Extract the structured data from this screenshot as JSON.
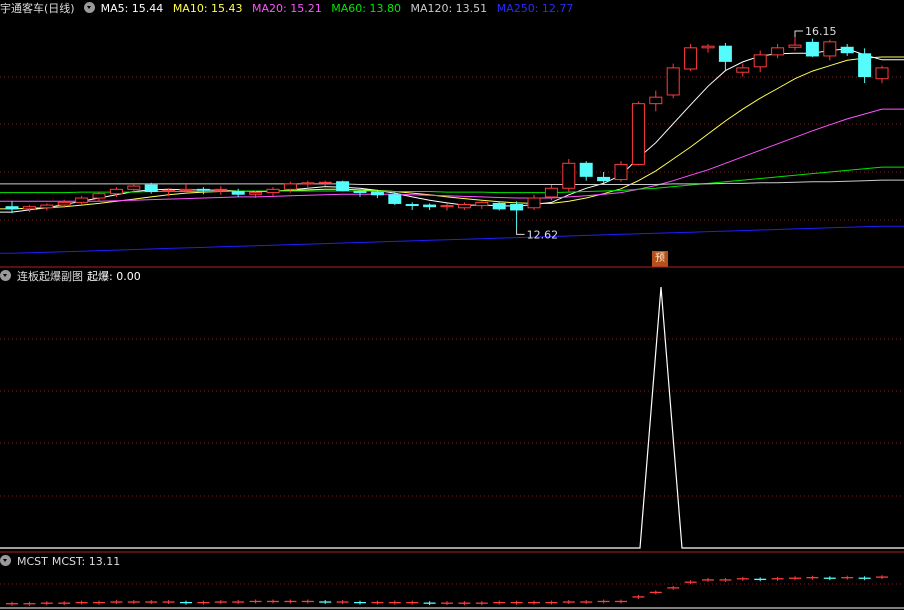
{
  "header": {
    "title": "宇通客车(日线)",
    "ma5": "MA5: 15.44",
    "ma10": "MA10: 15.43",
    "ma20": "MA20: 15.21",
    "ma60": "MA60: 13.80",
    "ma120": "MA120: 13.51",
    "ma250": "MA250: 12.77"
  },
  "price_panel": {
    "high_label": "16.15",
    "low_label": "12.62",
    "predict_badge": "预"
  },
  "panel2": {
    "title": "连板起爆副图",
    "value": "起爆: 0.00"
  },
  "panel3": {
    "title": "MCST",
    "value": "MCST: 13.11"
  },
  "colors": {
    "bg": "#000000",
    "up": "#ff3c3c",
    "down": "#54fcfc",
    "ma5": "#ffffff",
    "ma10": "#ffff54",
    "ma20": "#ff54ff",
    "ma60": "#00e600",
    "ma120": "#cccccc",
    "ma250": "#1e1eff",
    "grid": "#8a1a1a"
  },
  "chart_data": [
    {
      "type": "candlestick",
      "ohlc": [
        [
          13.02,
          13.12,
          12.9,
          12.98
        ],
        [
          12.98,
          13.05,
          12.92,
          13.02
        ],
        [
          13.0,
          13.08,
          12.95,
          13.05
        ],
        [
          13.05,
          13.15,
          13.0,
          13.1
        ],
        [
          13.1,
          13.22,
          13.05,
          13.18
        ],
        [
          13.18,
          13.3,
          13.12,
          13.26
        ],
        [
          13.26,
          13.38,
          13.2,
          13.34
        ],
        [
          13.34,
          13.44,
          13.28,
          13.4
        ],
        [
          13.42,
          13.46,
          13.26,
          13.3
        ],
        [
          13.3,
          13.36,
          13.22,
          13.32
        ],
        [
          13.32,
          13.46,
          13.27,
          13.34
        ],
        [
          13.34,
          13.38,
          13.25,
          13.33
        ],
        [
          13.33,
          13.4,
          13.24,
          13.34
        ],
        [
          13.3,
          13.35,
          13.2,
          13.25
        ],
        [
          13.25,
          13.32,
          13.18,
          13.28
        ],
        [
          13.28,
          13.38,
          13.22,
          13.34
        ],
        [
          13.34,
          13.48,
          13.28,
          13.44
        ],
        [
          13.44,
          13.5,
          13.36,
          13.46
        ],
        [
          13.46,
          13.5,
          13.4,
          13.47
        ],
        [
          13.48,
          13.5,
          13.3,
          13.32
        ],
        [
          13.3,
          13.34,
          13.2,
          13.29
        ],
        [
          13.29,
          13.32,
          13.18,
          13.24
        ],
        [
          13.24,
          13.3,
          13.05,
          13.08
        ],
        [
          13.06,
          13.1,
          12.96,
          13.05
        ],
        [
          13.05,
          13.08,
          12.96,
          13.02
        ],
        [
          13.02,
          13.08,
          12.95,
          13.04
        ],
        [
          13.0,
          13.1,
          12.96,
          13.06
        ],
        [
          13.04,
          13.12,
          12.98,
          13.1
        ],
        [
          13.08,
          13.12,
          12.95,
          12.98
        ],
        [
          13.06,
          13.12,
          12.62,
          12.96
        ],
        [
          13.0,
          13.24,
          12.96,
          13.18
        ],
        [
          13.2,
          13.42,
          13.14,
          13.36
        ],
        [
          13.36,
          13.9,
          13.3,
          13.82
        ],
        [
          13.82,
          13.86,
          13.5,
          13.58
        ],
        [
          13.56,
          13.66,
          13.46,
          13.5
        ],
        [
          13.52,
          13.86,
          13.48,
          13.8
        ],
        [
          13.8,
          14.96,
          13.78,
          14.92
        ],
        [
          14.92,
          15.16,
          14.78,
          15.04
        ],
        [
          15.08,
          15.66,
          15.02,
          15.58
        ],
        [
          15.56,
          16.02,
          15.52,
          15.95
        ],
        [
          15.95,
          16.02,
          15.86,
          15.98
        ],
        [
          15.98,
          16.04,
          15.54,
          15.7
        ],
        [
          15.5,
          15.66,
          15.42,
          15.58
        ],
        [
          15.6,
          15.9,
          15.5,
          15.82
        ],
        [
          15.82,
          16.02,
          15.76,
          15.95
        ],
        [
          15.96,
          16.15,
          15.9,
          16.0
        ],
        [
          16.05,
          16.12,
          15.78,
          15.8
        ],
        [
          15.8,
          16.1,
          15.72,
          16.06
        ],
        [
          15.96,
          16.02,
          15.8,
          15.86
        ],
        [
          15.84,
          15.94,
          15.3,
          15.42
        ],
        [
          15.38,
          15.62,
          15.3,
          15.58
        ]
      ],
      "ma_lines": {
        "MA5": [
          12.92,
          12.96,
          13.0,
          13.06,
          13.12,
          13.18,
          13.24,
          13.3,
          13.33,
          13.34,
          13.33,
          13.33,
          13.32,
          13.31,
          13.3,
          13.3,
          13.33,
          13.36,
          13.39,
          13.38,
          13.36,
          13.32,
          13.27,
          13.2,
          13.14,
          13.09,
          13.05,
          13.05,
          13.04,
          13.03,
          13.06,
          13.1,
          13.24,
          13.36,
          13.45,
          13.6,
          13.92,
          14.2,
          14.55,
          14.9,
          15.24,
          15.53,
          15.69,
          15.8,
          15.84,
          15.85,
          15.85,
          15.9,
          15.93,
          15.82,
          15.73
        ],
        "MA10": [
          12.98,
          12.99,
          13.0,
          13.02,
          13.05,
          13.08,
          13.12,
          13.16,
          13.2,
          13.24,
          13.27,
          13.29,
          13.3,
          13.31,
          13.31,
          13.31,
          13.32,
          13.33,
          13.34,
          13.34,
          13.33,
          13.32,
          13.3,
          13.27,
          13.24,
          13.2,
          13.17,
          13.14,
          13.11,
          13.09,
          13.08,
          13.08,
          13.12,
          13.18,
          13.26,
          13.35,
          13.5,
          13.68,
          13.9,
          14.12,
          14.36,
          14.6,
          14.82,
          15.02,
          15.2,
          15.38,
          15.52,
          15.62,
          15.72,
          15.76,
          15.78
        ],
        "MA20": [
          13.12,
          13.12,
          13.12,
          13.12,
          13.12,
          13.12,
          13.13,
          13.14,
          13.15,
          13.16,
          13.17,
          13.18,
          13.19,
          13.2,
          13.2,
          13.21,
          13.22,
          13.23,
          13.24,
          13.25,
          13.25,
          13.25,
          13.25,
          13.24,
          13.23,
          13.22,
          13.21,
          13.2,
          13.19,
          13.18,
          13.18,
          13.18,
          13.2,
          13.22,
          13.25,
          13.28,
          13.34,
          13.41,
          13.5,
          13.6,
          13.7,
          13.82,
          13.94,
          14.06,
          14.18,
          14.3,
          14.42,
          14.53,
          14.64,
          14.73,
          14.82
        ],
        "MA60": [
          13.28,
          13.28,
          13.28,
          13.28,
          13.29,
          13.29,
          13.29,
          13.29,
          13.3,
          13.3,
          13.3,
          13.3,
          13.3,
          13.31,
          13.31,
          13.31,
          13.31,
          13.31,
          13.31,
          13.31,
          13.31,
          13.31,
          13.3,
          13.3,
          13.3,
          13.29,
          13.29,
          13.29,
          13.28,
          13.28,
          13.28,
          13.28,
          13.29,
          13.3,
          13.31,
          13.32,
          13.34,
          13.36,
          13.39,
          13.42,
          13.45,
          13.48,
          13.51,
          13.54,
          13.57,
          13.6,
          13.63,
          13.66,
          13.69,
          13.72,
          13.75
        ],
        "MA120": [
          13.44,
          13.44,
          13.44,
          13.44,
          13.44,
          13.44,
          13.44,
          13.44,
          13.44,
          13.44,
          13.44,
          13.44,
          13.44,
          13.44,
          13.44,
          13.44,
          13.44,
          13.44,
          13.44,
          13.44,
          13.43,
          13.43,
          13.43,
          13.43,
          13.43,
          13.43,
          13.43,
          13.43,
          13.43,
          13.43,
          13.43,
          13.43,
          13.43,
          13.43,
          13.43,
          13.43,
          13.43,
          13.43,
          13.44,
          13.44,
          13.44,
          13.45,
          13.45,
          13.46,
          13.46,
          13.47,
          13.48,
          13.48,
          13.49,
          13.5,
          13.51
        ],
        "MA250": [
          12.16,
          12.17,
          12.18,
          12.19,
          12.2,
          12.21,
          12.22,
          12.23,
          12.24,
          12.25,
          12.26,
          12.27,
          12.28,
          12.29,
          12.3,
          12.31,
          12.32,
          12.33,
          12.34,
          12.35,
          12.36,
          12.37,
          12.38,
          12.39,
          12.4,
          12.41,
          12.42,
          12.43,
          12.44,
          12.45,
          12.46,
          12.47,
          12.48,
          12.49,
          12.5,
          12.51,
          12.52,
          12.53,
          12.54,
          12.55,
          12.56,
          12.57,
          12.58,
          12.59,
          12.6,
          12.61,
          12.62,
          12.63,
          12.64,
          12.65,
          12.66
        ]
      },
      "high_index": 45,
      "low_index": 29,
      "predict_index": 38
    },
    {
      "type": "line",
      "name": "起爆",
      "values": [
        0,
        0,
        0,
        0,
        0,
        0,
        0,
        0,
        0,
        0,
        0,
        0,
        0,
        0,
        0,
        0,
        0,
        0,
        0,
        0,
        0,
        0,
        0,
        0,
        0,
        0,
        0,
        0,
        0,
        0,
        0,
        0,
        0,
        0,
        0,
        0,
        0,
        1,
        0,
        0,
        0,
        0,
        0,
        0,
        0,
        0,
        0,
        0,
        0,
        0,
        0
      ]
    },
    {
      "type": "step",
      "name": "MCST",
      "values": [
        12.64,
        12.64,
        12.65,
        12.65,
        12.66,
        12.66,
        12.67,
        12.67,
        12.67,
        12.67,
        12.66,
        12.66,
        12.67,
        12.67,
        12.68,
        12.68,
        12.68,
        12.68,
        12.67,
        12.67,
        12.66,
        12.66,
        12.66,
        12.66,
        12.65,
        12.65,
        12.65,
        12.65,
        12.66,
        12.66,
        12.66,
        12.66,
        12.67,
        12.67,
        12.68,
        12.68,
        12.76,
        12.84,
        12.92,
        13.02,
        13.06,
        13.06,
        13.08,
        13.07,
        13.08,
        13.09,
        13.1,
        13.09,
        13.1,
        13.09,
        13.11
      ]
    }
  ]
}
